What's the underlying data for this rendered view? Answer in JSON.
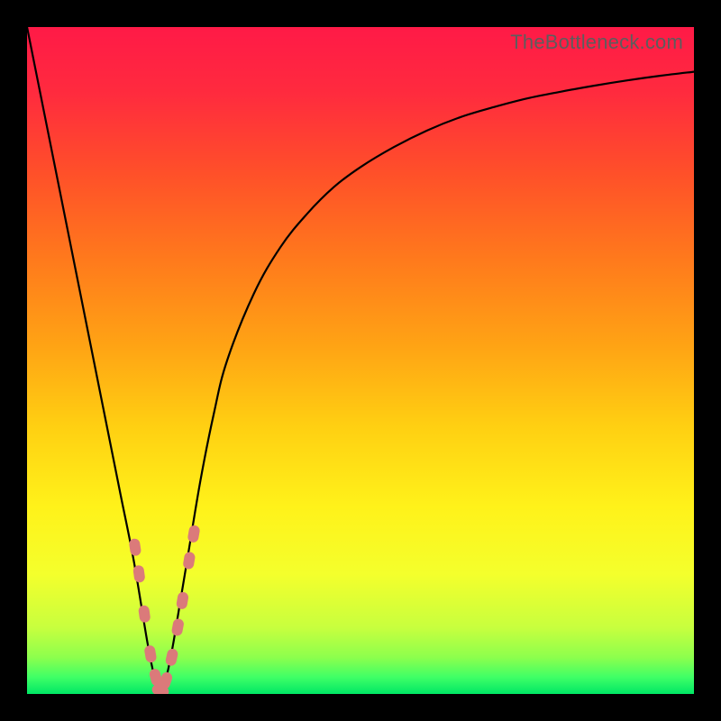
{
  "watermark": "TheBottleneck.com",
  "chart_data": {
    "type": "line",
    "title": "",
    "xlabel": "",
    "ylabel": "",
    "xlim": [
      0,
      100
    ],
    "ylim": [
      0,
      100
    ],
    "series": [
      {
        "name": "bottleneck-curve",
        "x": [
          0,
          2,
          4,
          6,
          8,
          10,
          12,
          14,
          16,
          18,
          19,
          20,
          21,
          22,
          24,
          26,
          28,
          30,
          34,
          38,
          42,
          46,
          50,
          55,
          60,
          65,
          70,
          75,
          80,
          85,
          90,
          95,
          100
        ],
        "y": [
          100,
          90,
          80,
          70,
          60,
          50,
          40,
          30,
          20,
          8,
          3,
          0,
          3,
          8,
          20,
          32,
          42,
          50,
          60,
          67,
          72,
          76,
          79,
          82,
          84.5,
          86.5,
          88,
          89.3,
          90.3,
          91.2,
          92,
          92.7,
          93.3
        ]
      }
    ],
    "markers": {
      "name": "highlight-points",
      "color": "#db7a7a",
      "points": [
        {
          "x": 16.2,
          "y": 22
        },
        {
          "x": 16.8,
          "y": 18
        },
        {
          "x": 17.6,
          "y": 12
        },
        {
          "x": 18.5,
          "y": 6
        },
        {
          "x": 19.3,
          "y": 2.5
        },
        {
          "x": 20.0,
          "y": 0.5
        },
        {
          "x": 20.8,
          "y": 2
        },
        {
          "x": 21.7,
          "y": 5.5
        },
        {
          "x": 22.6,
          "y": 10
        },
        {
          "x": 23.3,
          "y": 14
        },
        {
          "x": 24.3,
          "y": 20
        },
        {
          "x": 25.0,
          "y": 24
        }
      ]
    },
    "gradient_stops": [
      {
        "offset": 0.0,
        "color": "#ff1a47"
      },
      {
        "offset": 0.1,
        "color": "#ff2b3e"
      },
      {
        "offset": 0.22,
        "color": "#ff5029"
      },
      {
        "offset": 0.35,
        "color": "#ff7a1c"
      },
      {
        "offset": 0.48,
        "color": "#ffa414"
      },
      {
        "offset": 0.6,
        "color": "#ffd012"
      },
      {
        "offset": 0.72,
        "color": "#fff21a"
      },
      {
        "offset": 0.82,
        "color": "#f4ff2c"
      },
      {
        "offset": 0.9,
        "color": "#c8ff3e"
      },
      {
        "offset": 0.945,
        "color": "#8dff4d"
      },
      {
        "offset": 0.975,
        "color": "#3fff66"
      },
      {
        "offset": 1.0,
        "color": "#00e765"
      }
    ]
  }
}
